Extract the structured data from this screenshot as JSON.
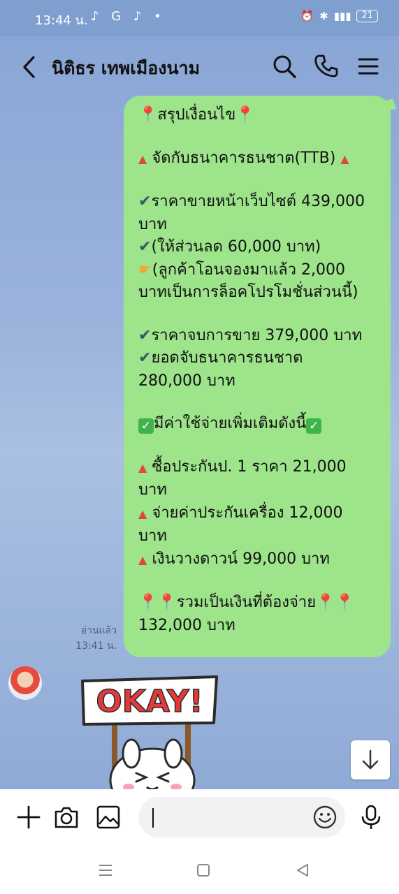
{
  "status_bar": {
    "time": "13:44 น.",
    "app_icons": "♪ G ♪ •",
    "battery": "21"
  },
  "header": {
    "contact_name": "นิติธร เทพเมืองนาม"
  },
  "message": {
    "l1_text": "สรุปเงื่อนไข",
    "l2_text": "จัดกับธนาคารธนชาต(TTB)",
    "l3_text": "ราคาขายหน้าเว็บไซต์ 439,000",
    "l4_text": "บาท",
    "l5_text": "(ให้ส่วนลด 60,000 บาท)",
    "l6_text": "(ลูกค้าโอนจองมาแล้ว 2,000",
    "l7_text": "บาทเป็นการล็อคโปรโมชั่นส่วนนี้)",
    "l8_text": "ราคาจบการขาย 379,000 บาท",
    "l9_text": "ยอดจับธนาคารธนชาต",
    "l10_text": "280,000 บาท",
    "l11_text": "มีค่าใช้จ่ายเพิ่มเติมดังนี้",
    "l12_text": "ซื้อประกันป. 1 ราคา 21,000",
    "l13_text": "บาท",
    "l14_text": "จ่ายค่าประกันเครื่อง 12,000",
    "l15_text": "บาท",
    "l16_text": "เงินวางดาวน์ 99,000 บาท",
    "l17_text": "รวมเป็นเงินที่ต้องจ่าย",
    "l18_text": "132,000 บาท"
  },
  "read_status": {
    "label": "อ่านแล้ว",
    "time": "13:41 น."
  },
  "sticker": {
    "text": "OKAY!"
  },
  "input": {
    "placeholder": ""
  },
  "colors": {
    "bubble": "#9de48b",
    "chat_background": "#8faad6",
    "accent_red": "#e0483d"
  }
}
